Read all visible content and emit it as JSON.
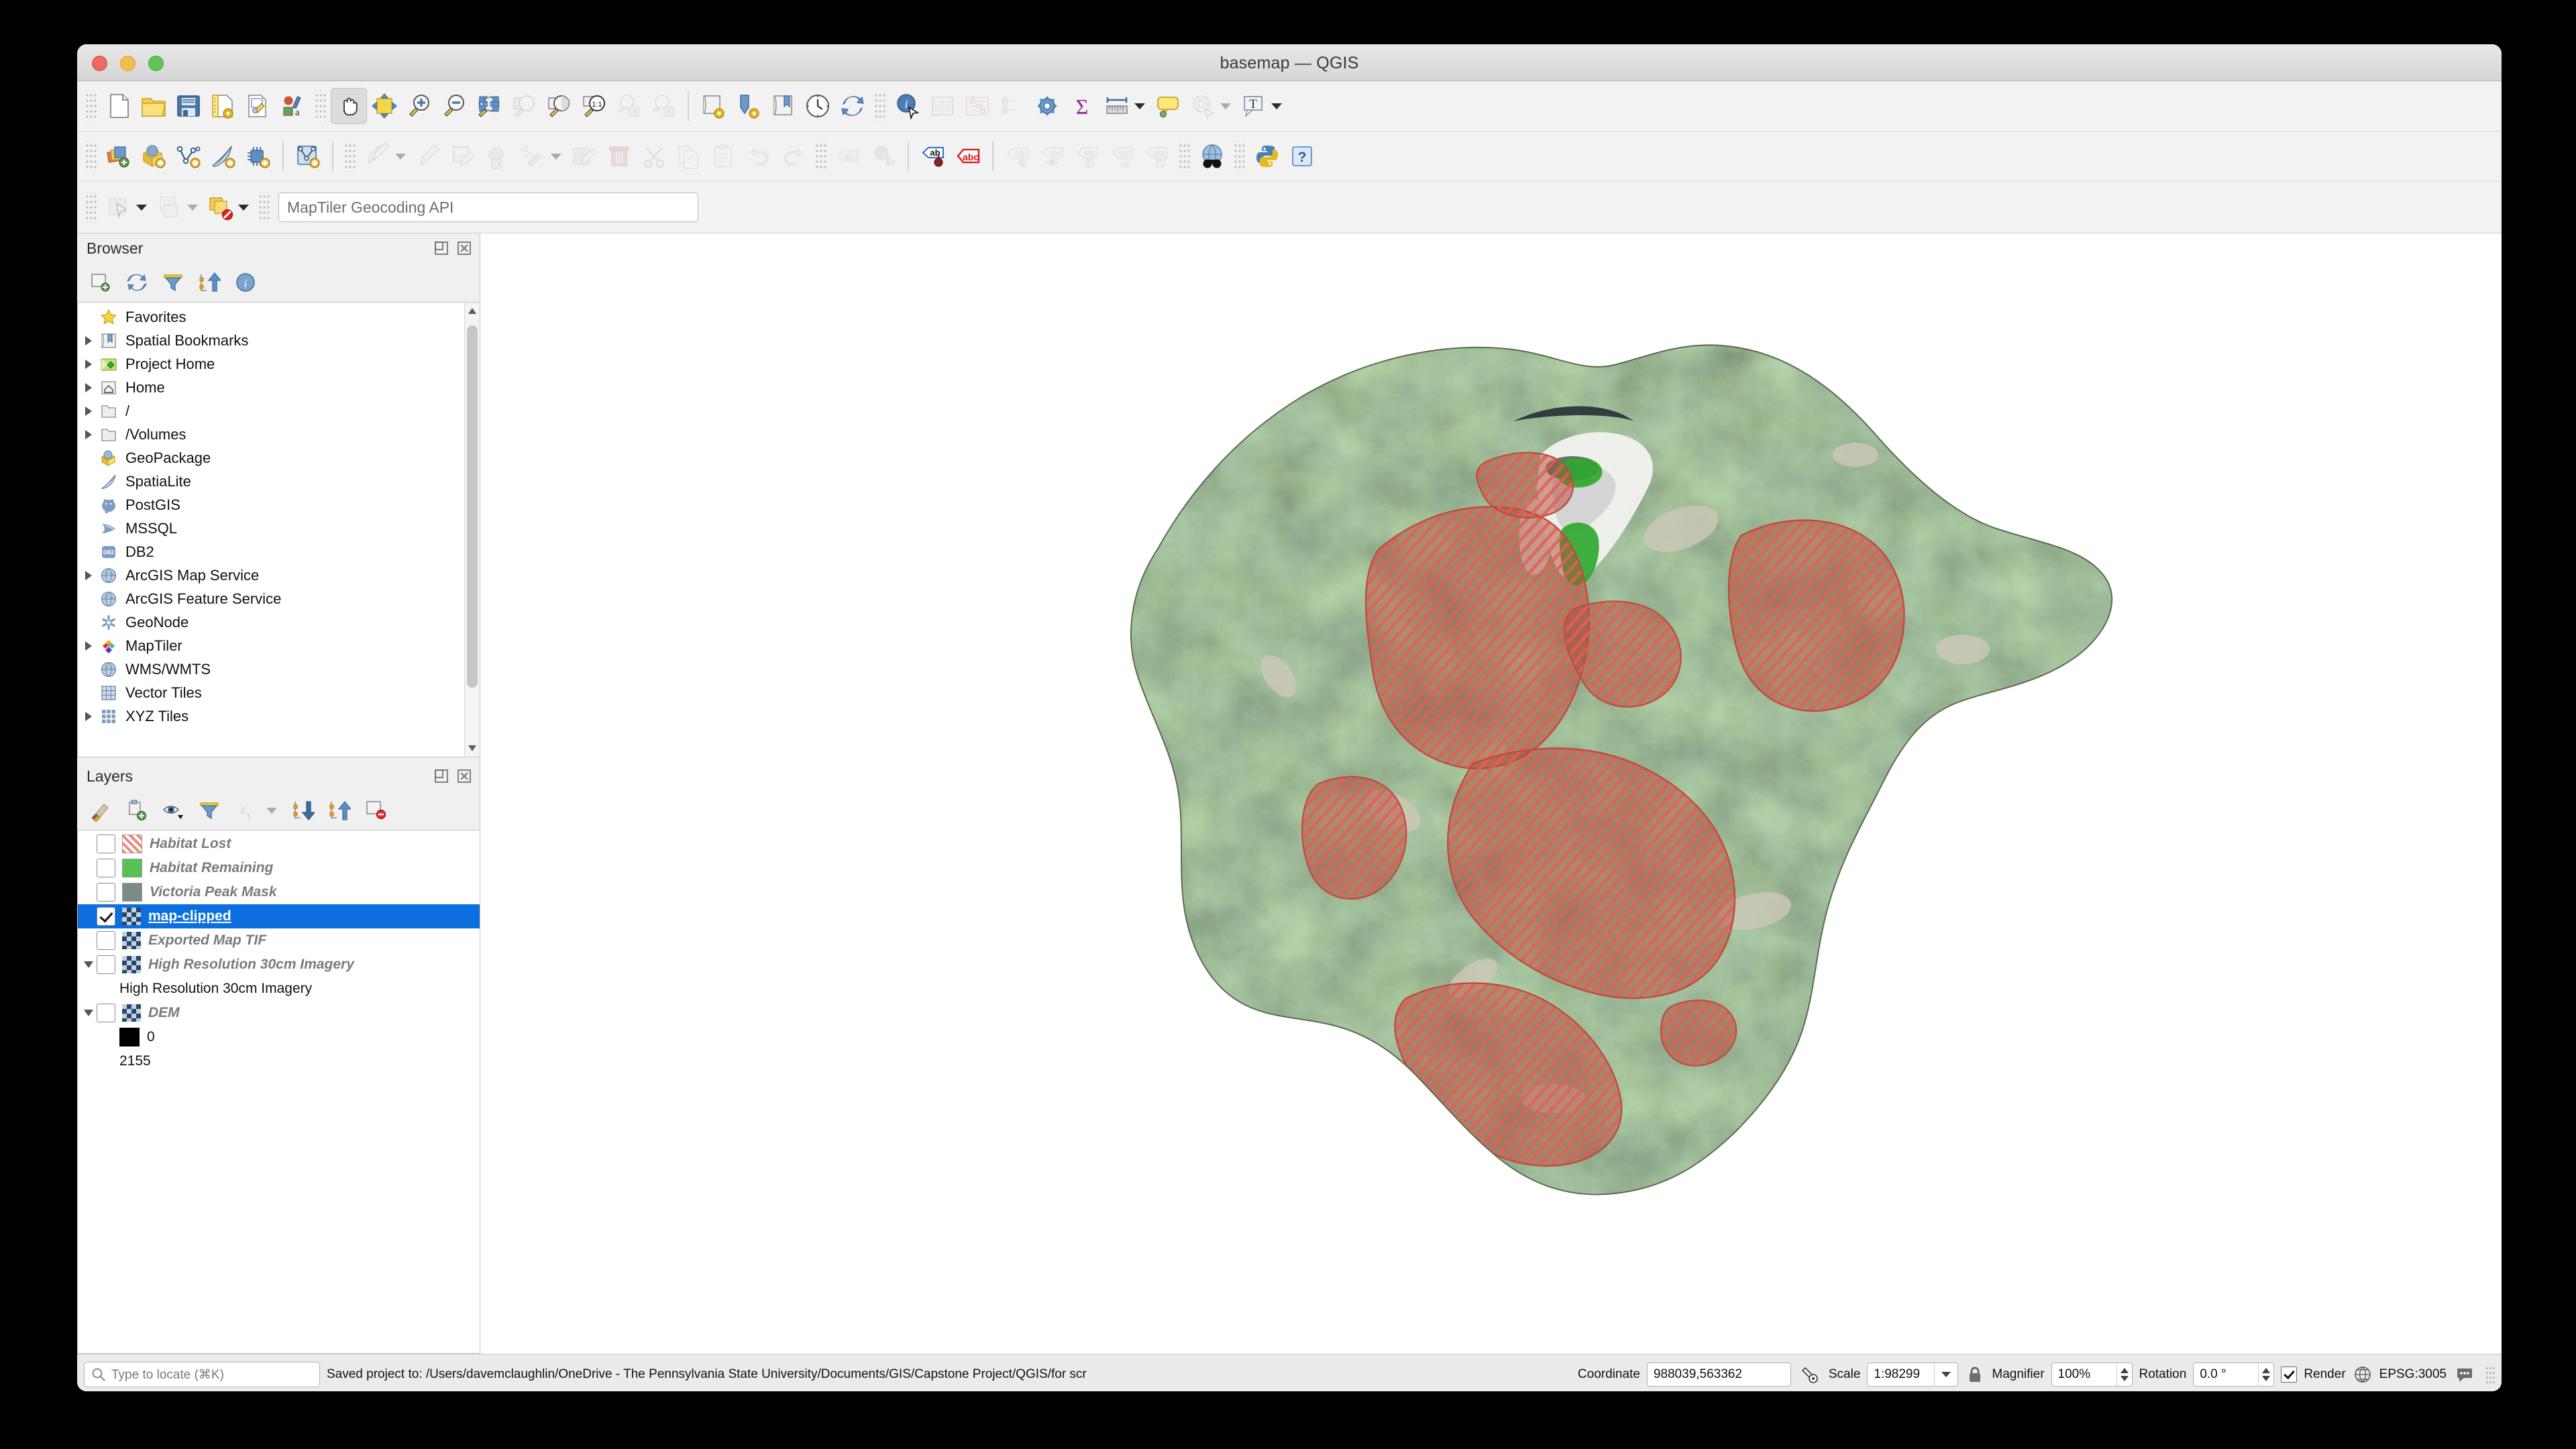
{
  "window": {
    "title": "basemap — QGIS",
    "traffic_lights": [
      "close",
      "minimize",
      "zoom"
    ]
  },
  "toolbars": {
    "row1": [
      {
        "name": "new-project-icon",
        "label": "New Project"
      },
      {
        "name": "open-project-icon",
        "label": "Open Project"
      },
      {
        "name": "save-project-icon",
        "label": "Save Project"
      },
      {
        "name": "new-print-layout-icon",
        "label": "New Print Layout"
      },
      {
        "name": "layout-manager-icon",
        "label": "Layout Manager"
      },
      {
        "name": "style-manager-icon",
        "label": "Style Manager"
      },
      {
        "name": "pan-map-icon",
        "label": "Pan Map",
        "active": true
      },
      {
        "name": "pan-to-selection-icon",
        "label": "Pan Map to Selection"
      },
      {
        "name": "zoom-in-icon",
        "label": "Zoom In"
      },
      {
        "name": "zoom-out-icon",
        "label": "Zoom Out"
      },
      {
        "name": "zoom-full-icon",
        "label": "Zoom Full"
      },
      {
        "name": "zoom-to-selection-icon",
        "label": "Zoom to Selection"
      },
      {
        "name": "zoom-to-layer-icon",
        "label": "Zoom to Layer"
      },
      {
        "name": "zoom-native-icon",
        "label": "Zoom to Native Resolution (1:1)"
      },
      {
        "name": "zoom-last-icon",
        "label": "Zoom Last"
      },
      {
        "name": "zoom-next-icon",
        "label": "Zoom Next"
      },
      {
        "name": "new-map-view-icon",
        "label": "New Map View"
      },
      {
        "name": "new-3d-map-view-icon",
        "label": "New 3D Map View"
      },
      {
        "name": "show-bookmarks-icon",
        "label": "Show Spatial Bookmarks"
      },
      {
        "name": "temporal-controller-icon",
        "label": "Temporal Controller Panel"
      },
      {
        "name": "refresh-icon",
        "label": "Refresh"
      },
      {
        "name": "identify-features-icon",
        "label": "Identify Features"
      },
      {
        "name": "attribute-table-icon",
        "label": "Open Attribute Table"
      },
      {
        "name": "field-calculator-icon",
        "label": "Field Calculator"
      },
      {
        "name": "processing-toolbox-icon",
        "label": "Processing Toolbox"
      },
      {
        "name": "statistical-summary-icon",
        "label": "Statistical Summary"
      },
      {
        "name": "measure-line-icon",
        "label": "Measure Line"
      },
      {
        "name": "measure-dropdown-caret",
        "label": "Measure options"
      },
      {
        "name": "map-tips-icon",
        "label": "Show Map Tips"
      },
      {
        "name": "run-model-icon",
        "label": "Run Model"
      },
      {
        "name": "run-model-caret",
        "label": "Run Model options"
      },
      {
        "name": "text-annotation-icon",
        "label": "Text Annotation"
      },
      {
        "name": "annotation-caret",
        "label": "Annotation options"
      }
    ],
    "row2": [
      {
        "name": "open-data-source-manager-icon",
        "label": "Open Data Source Manager"
      },
      {
        "name": "new-geopackage-layer-icon",
        "label": "New GeoPackage Layer"
      },
      {
        "name": "new-shapefile-layer-icon",
        "label": "New Shapefile Layer"
      },
      {
        "name": "new-spatialite-layer-icon",
        "label": "New SpatiaLite Layer"
      },
      {
        "name": "new-memory-layer-icon",
        "label": "New Temporary Scratch Layer"
      },
      {
        "name": "new-virtual-layer-icon",
        "label": "New Virtual Layer"
      },
      {
        "name": "current-edits-icon",
        "label": "Current Edits"
      },
      {
        "name": "toggle-editing-icon",
        "label": "Toggle Editing"
      },
      {
        "name": "save-layer-edits-icon",
        "label": "Save Layer Edits"
      },
      {
        "name": "vertex-tool-icon",
        "label": "Vertex Tool"
      },
      {
        "name": "modify-attributes-icon",
        "label": "Modify Attributes of Features"
      },
      {
        "name": "modify-attributes-caret",
        "label": "Modify options"
      },
      {
        "name": "multi-edit-icon",
        "label": "Multi-Edit"
      },
      {
        "name": "delete-selected-icon",
        "label": "Delete Selected"
      },
      {
        "name": "cut-features-icon",
        "label": "Cut Features"
      },
      {
        "name": "copy-features-icon",
        "label": "Copy Features"
      },
      {
        "name": "paste-features-icon",
        "label": "Paste Features"
      },
      {
        "name": "undo-icon",
        "label": "Undo"
      },
      {
        "name": "redo-icon",
        "label": "Redo"
      },
      {
        "name": "label-toolbar-icon",
        "label": "Layer Labeling Options"
      },
      {
        "name": "diagram-icon",
        "label": "Layer Diagram Options"
      },
      {
        "name": "highlight-pinned-labels-icon",
        "label": "Highlight Pinned Labels"
      },
      {
        "name": "show-hide-labels-icon",
        "label": "Show/Hide Labels"
      },
      {
        "name": "pin-labels-icon",
        "label": "Pin/Unpin Labels"
      },
      {
        "name": "show-unplaced-labels-icon",
        "label": "Show Unplaced Labels"
      },
      {
        "name": "move-label-icon",
        "label": "Move Label"
      },
      {
        "name": "rotate-label-icon",
        "label": "Rotate Label"
      },
      {
        "name": "change-label-icon",
        "label": "Change Label"
      },
      {
        "name": "metasearch-icon",
        "label": "MetaSearch"
      },
      {
        "name": "python-console-icon",
        "label": "Python Console"
      },
      {
        "name": "help-icon",
        "label": "Help"
      }
    ],
    "row3": {
      "select-features-icon": "Select Features by Area or Single Click",
      "select-caret": "Select options",
      "select-by-expression-icon": "Select Features by Value",
      "select-value-caret": "Select value options",
      "deselect-features-icon": "Deselect Features from All Layers",
      "deselect-caret": "Deselect options",
      "geocoder_placeholder": "MapTiler Geocoding API",
      "geocoder_value": ""
    }
  },
  "browser": {
    "title": "Browser",
    "panel_buttons": [
      "undock-icon",
      "close-icon"
    ],
    "tools": [
      {
        "name": "add-layers-icon",
        "label": "Add Selected Layers"
      },
      {
        "name": "refresh-icon",
        "label": "Refresh"
      },
      {
        "name": "filter-browser-icon",
        "label": "Filter Browser"
      },
      {
        "name": "collapse-all-icon",
        "label": "Collapse All"
      },
      {
        "name": "show-properties-icon",
        "label": "Enable/disable properties widget"
      }
    ],
    "items": [
      {
        "label": "Favorites",
        "icon": "star-icon",
        "expandable": false
      },
      {
        "label": "Spatial Bookmarks",
        "icon": "bookmark-icon",
        "expandable": true
      },
      {
        "label": "Project Home",
        "icon": "project-home-icon",
        "expandable": true
      },
      {
        "label": "Home",
        "icon": "home-icon",
        "expandable": true
      },
      {
        "label": "/",
        "icon": "folder-icon",
        "expandable": true
      },
      {
        "label": "/Volumes",
        "icon": "folder-icon",
        "expandable": true
      },
      {
        "label": "GeoPackage",
        "icon": "geopackage-icon",
        "expandable": false
      },
      {
        "label": "SpatiaLite",
        "icon": "spatialite-icon",
        "expandable": false
      },
      {
        "label": "PostGIS",
        "icon": "postgis-icon",
        "expandable": false
      },
      {
        "label": "MSSQL",
        "icon": "mssql-icon",
        "expandable": false
      },
      {
        "label": "DB2",
        "icon": "db2-icon",
        "expandable": false
      },
      {
        "label": "ArcGIS Map Service",
        "icon": "arcgis-map-service-icon",
        "expandable": true
      },
      {
        "label": "ArcGIS Feature Service",
        "icon": "arcgis-feature-service-icon",
        "expandable": false
      },
      {
        "label": "GeoNode",
        "icon": "geonode-icon",
        "expandable": false
      },
      {
        "label": "MapTiler",
        "icon": "maptiler-icon",
        "expandable": true
      },
      {
        "label": "WMS/WMTS",
        "icon": "wms-icon",
        "expandable": false
      },
      {
        "label": "Vector Tiles",
        "icon": "vector-tiles-icon",
        "expandable": false
      },
      {
        "label": "XYZ Tiles",
        "icon": "xyz-tiles-icon",
        "expandable": true
      }
    ]
  },
  "layers": {
    "title": "Layers",
    "panel_buttons": [
      "undock-icon",
      "close-icon"
    ],
    "tools": [
      {
        "name": "open-layer-styling-icon",
        "label": "Open the Layer Styling panel"
      },
      {
        "name": "add-group-icon",
        "label": "Add Group"
      },
      {
        "name": "manage-visibility-icon",
        "label": "Manage Map Themes"
      },
      {
        "name": "filter-legend-icon",
        "label": "Filter Legend"
      },
      {
        "name": "expression-filter-icon",
        "label": "Filter Legend by Expression"
      },
      {
        "name": "expression-caret",
        "label": "Expression options"
      },
      {
        "name": "expand-all-icon",
        "label": "Expand All"
      },
      {
        "name": "collapse-all-icon",
        "label": "Collapse All"
      },
      {
        "name": "remove-layer-icon",
        "label": "Remove Layer/Group"
      }
    ],
    "items": [
      {
        "label": "Habitat Lost",
        "checked": false,
        "selected": false,
        "swatch": "hatch-red",
        "expandable": false,
        "indent": 0,
        "style": "italic"
      },
      {
        "label": "Habitat Remaining",
        "checked": false,
        "selected": false,
        "swatch": "green",
        "expandable": false,
        "indent": 0,
        "style": "italic"
      },
      {
        "label": "Victoria Peak Mask",
        "checked": false,
        "selected": false,
        "swatch": "gray",
        "expandable": false,
        "indent": 0,
        "style": "italic"
      },
      {
        "label": "map-clipped",
        "checked": true,
        "selected": true,
        "swatch": "raster",
        "expandable": false,
        "indent": 0,
        "style": "selected"
      },
      {
        "label": "Exported Map TIF",
        "checked": false,
        "selected": false,
        "swatch": "raster",
        "expandable": false,
        "indent": 0,
        "style": "italic"
      },
      {
        "label": "High Resolution 30cm Imagery",
        "checked": false,
        "selected": false,
        "swatch": "raster",
        "expandable": true,
        "expanded": true,
        "indent": 0,
        "style": "italic"
      },
      {
        "label": "High Resolution 30cm Imagery",
        "checked": null,
        "selected": false,
        "swatch": null,
        "expandable": false,
        "indent": 1,
        "style": "plain"
      },
      {
        "label": "DEM",
        "checked": false,
        "selected": false,
        "swatch": "raster",
        "expandable": true,
        "expanded": true,
        "indent": 0,
        "style": "italic"
      },
      {
        "label": "0",
        "checked": null,
        "selected": false,
        "swatch": "black",
        "expandable": false,
        "indent": 1,
        "style": "plain"
      },
      {
        "label": "2155",
        "checked": null,
        "selected": false,
        "swatch": null,
        "expandable": false,
        "indent": 1,
        "style": "plain"
      }
    ]
  },
  "map": {
    "description": "Aerial satellite imagery of a forested mountain watershed clipped to an irregular polygon boundary, overlaid with red hatched habitat-lost polygons and small green habitat-remaining patches near a snow/rock area."
  },
  "status": {
    "locate_placeholder": "Type to locate (⌘K)",
    "saved_message": "Saved project to: /Users/davemclaughlin/OneDrive - The Pennsylvania State University/Documents/GIS/Capstone Project/QGIS/for scr",
    "coordinate_label": "Coordinate",
    "coordinate_value": "988039,563362",
    "scale_label": "Scale",
    "scale_value": "1:98299",
    "magnifier_label": "Magnifier",
    "magnifier_value": "100%",
    "rotation_label": "Rotation",
    "rotation_value": "0.0 °",
    "render_label": "Render",
    "render_checked": true,
    "crs_label": "EPSG:3005",
    "icons": [
      "lock-icon",
      "globe-icon",
      "messages-icon"
    ]
  }
}
